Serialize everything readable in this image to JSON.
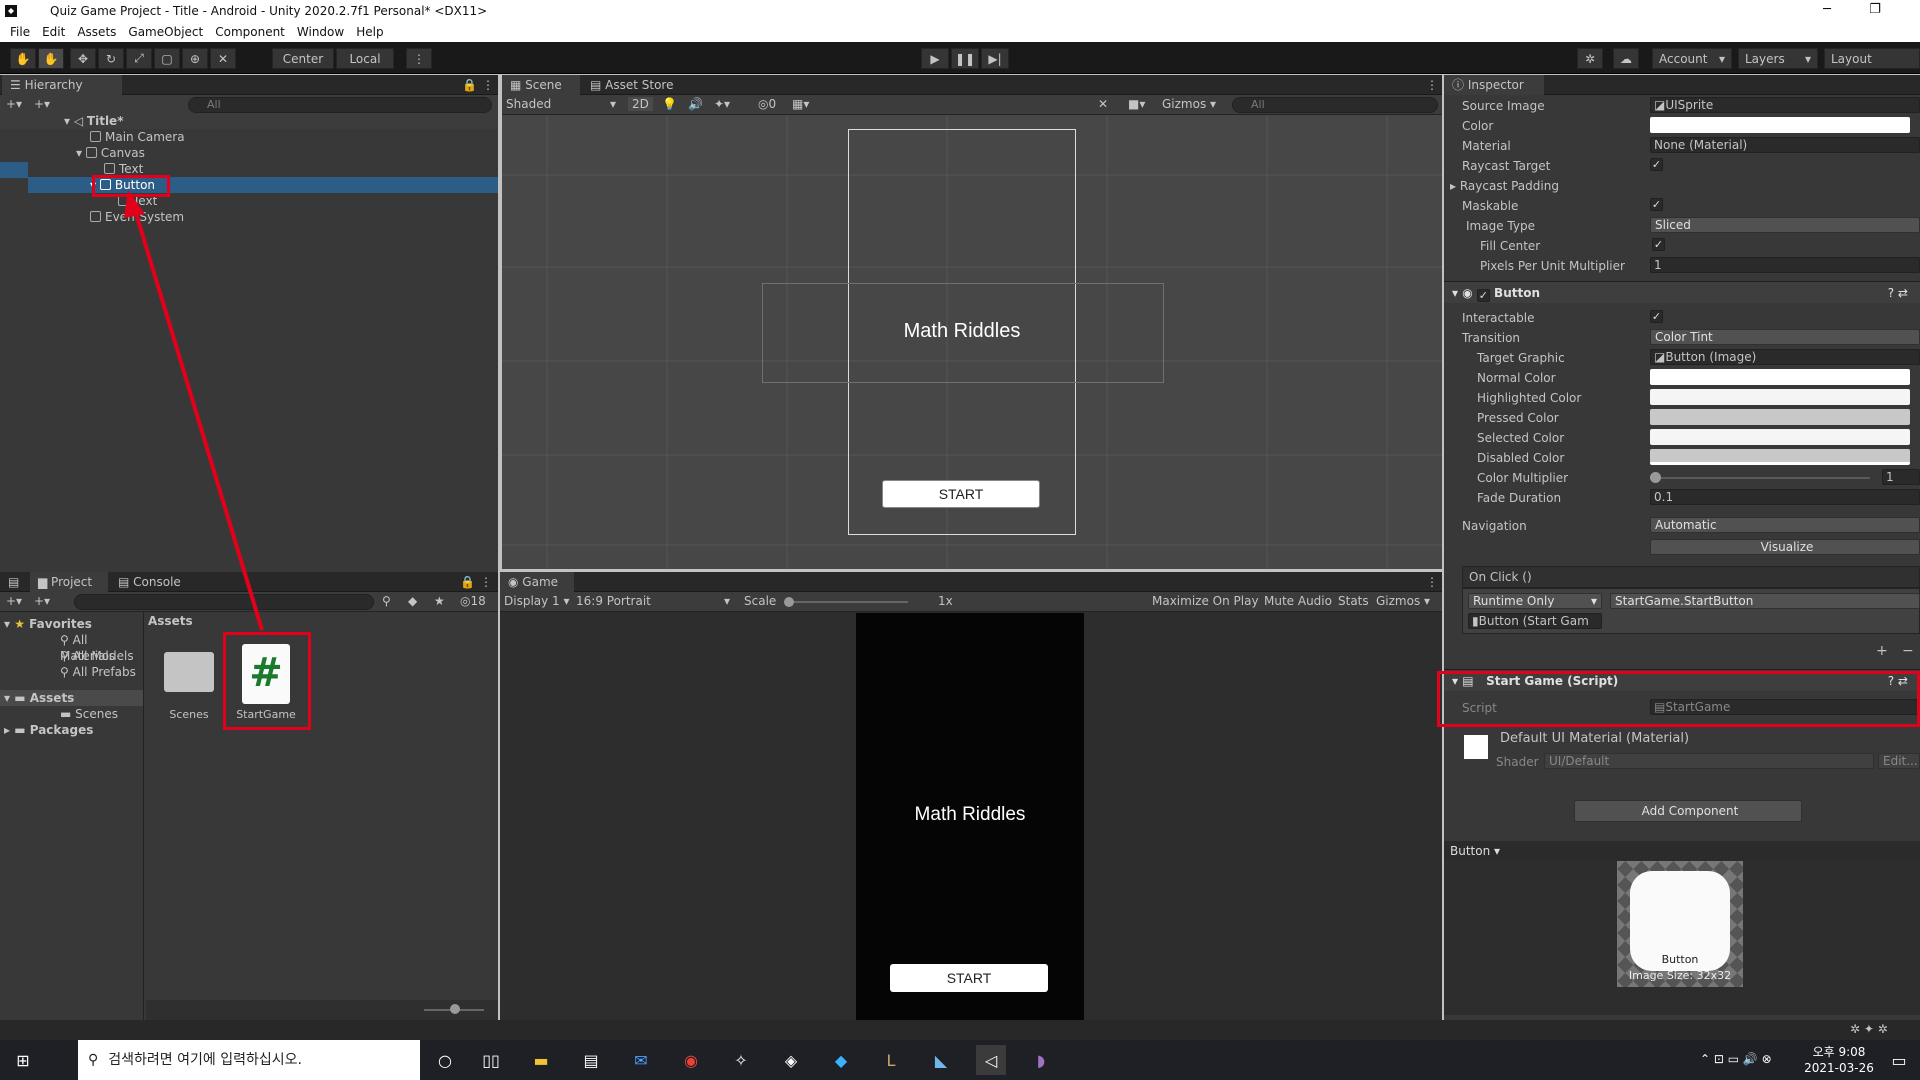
{
  "window": {
    "title": "Quiz Game Project - Title - Android - Unity 2020.2.7f1 Personal* <DX11>",
    "minimize": "─",
    "restore": "❐"
  },
  "menu": [
    "File",
    "Edit",
    "Assets",
    "GameObject",
    "Component",
    "Window",
    "Help"
  ],
  "toolbar": {
    "center": "Center",
    "local": "Local",
    "account": "Account",
    "layers": "Layers",
    "layout": "Layout"
  },
  "hierarchy": {
    "tab": "Hierarchy",
    "search_placeholder": "All",
    "scene": "Title*",
    "items": [
      "Main Camera",
      "Canvas",
      "Text",
      "Button",
      "Text",
      "EventSystem"
    ]
  },
  "scene": {
    "tab_scene": "Scene",
    "tab_store": "Asset Store",
    "shading": "Shaded",
    "mode_2d": "2D",
    "hidden_count": "0",
    "gizmos": "Gizmos",
    "search_placeholder": "All",
    "title_text": "Math Riddles",
    "button_text": "START"
  },
  "project": {
    "tab_project": "Project",
    "tab_console": "Console",
    "hidden_count": "18",
    "favorites": "Favorites",
    "fav_items": [
      "All Materials",
      "All Models",
      "All Prefabs"
    ],
    "tree_assets": "Assets",
    "tree_scenes": "Scenes",
    "tree_packages": "Packages",
    "breadcrumb": "Assets",
    "assets": [
      {
        "name": "Scenes",
        "icon": "folder-icon"
      },
      {
        "name": "StartGame",
        "icon": "csharp-script-icon",
        "glyph": "#"
      }
    ]
  },
  "game": {
    "tab": "Game",
    "display": "Display 1",
    "aspect": "16:9 Portrait",
    "scale_label": "Scale",
    "scale_value": "1x",
    "maximize": "Maximize On Play",
    "mute": "Mute Audio",
    "stats": "Stats",
    "gizmos": "Gizmos",
    "title_text": "Math Riddles",
    "button_text": "START"
  },
  "inspector": {
    "tab": "Inspector",
    "image": {
      "source_image_label": "Source Image",
      "source_image": "UISprite",
      "color_label": "Color",
      "material_label": "Material",
      "material": "None (Material)",
      "raycast_target_label": "Raycast Target",
      "raycast_padding_label": "Raycast Padding",
      "maskable_label": "Maskable",
      "image_type_label": "Image Type",
      "image_type": "Sliced",
      "fill_center_label": "Fill Center",
      "ppu_label": "Pixels Per Unit Multiplier",
      "ppu": "1"
    },
    "button": {
      "header": "Button",
      "interactable_label": "Interactable",
      "transition_label": "Transition",
      "transition": "Color Tint",
      "target_graphic_label": "Target Graphic",
      "target_graphic": "Button (Image)",
      "normal_label": "Normal Color",
      "highlighted_label": "Highlighted Color",
      "pressed_label": "Pressed Color",
      "selected_label": "Selected Color",
      "disabled_label": "Disabled Color",
      "multiplier_label": "Color Multiplier",
      "multiplier": "1",
      "fade_label": "Fade Duration",
      "fade": "0.1",
      "navigation_label": "Navigation",
      "navigation": "Automatic",
      "visualize": "Visualize",
      "onclick_header": "On Click ()",
      "runtime": "Runtime Only",
      "function": "StartGame.StartButton",
      "object": "Button (Start Gam",
      "plus": "+",
      "minus": "−"
    },
    "script_comp": {
      "header": "Start Game (Script)",
      "script_label": "Script",
      "script": "StartGame"
    },
    "material": {
      "name": "Default UI Material (Material)",
      "shader_label": "Shader",
      "shader": "UI/Default",
      "edit": "Edit..."
    },
    "add_component": "Add Component",
    "preview": {
      "dropdown": "Button",
      "name": "Button",
      "size": "Image Size: 32x32"
    }
  },
  "taskbar": {
    "search_placeholder": "검색하려면 여기에 입력하십시오.",
    "time": "오후 9:08",
    "date": "2021-03-26"
  },
  "colors": {
    "selection": "#2c5d87",
    "highlight_red": "#e3001b",
    "script_green": "#1a7a2e"
  }
}
